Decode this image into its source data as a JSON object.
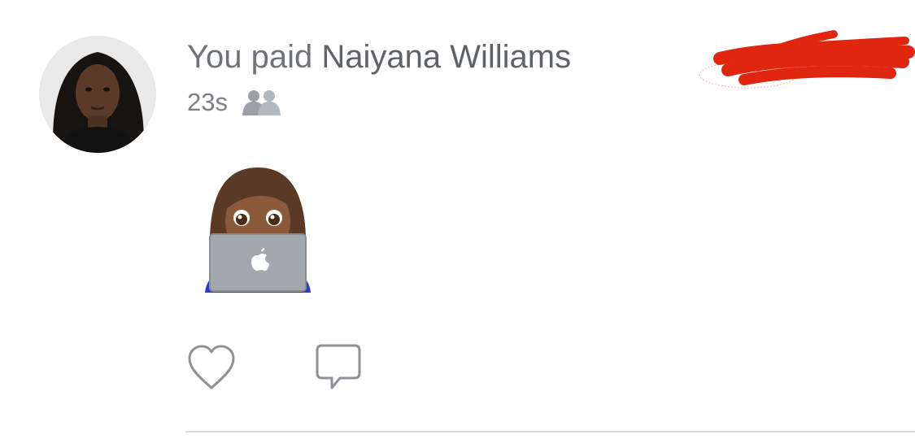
{
  "feed_item": {
    "headline_prefix": "You paid",
    "recipient_name": "Naiyana Williams",
    "timestamp": "23s",
    "audience_icon": "friends-icon",
    "note_emoji": "woman-technologist-emoji",
    "redacted_amount": "",
    "actions": {
      "like_icon": "heart-outline-icon",
      "comment_icon": "speech-bubble-outline-icon"
    }
  },
  "colors": {
    "text_primary": "#5f6368",
    "text_secondary": "#7b7f84",
    "icon_gray": "#9aa0a6",
    "redaction_red": "#e0260f",
    "divider": "#d9dadc"
  }
}
